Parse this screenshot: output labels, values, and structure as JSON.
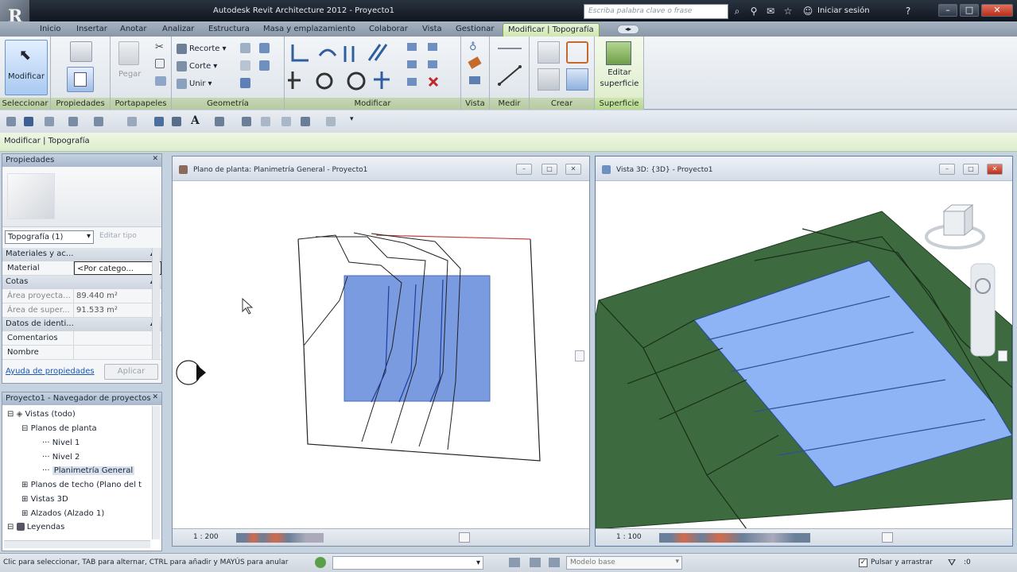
{
  "window": {
    "title": "Autodesk Revit Architecture 2012 -    Proyecto1",
    "search_placeholder": "Escriba palabra clave o frase",
    "signin": "Iniciar sesión"
  },
  "tabs": [
    "Inicio",
    "Insertar",
    "Anotar",
    "Analizar",
    "Estructura",
    "Masa y emplazamiento",
    "Colaborar",
    "Vista",
    "Gestionar",
    "Modificar | Topografía"
  ],
  "ribbon": {
    "modify_label": "Modificar",
    "paste_label": "Pegar",
    "recorte_label": "Recorte",
    "corte_label": "Corte",
    "unir_label": "Unir",
    "editar_label": "Editar",
    "superficie_label": "superficie",
    "panels": {
      "seleccionar": "Seleccionar",
      "propiedades": "Propiedades",
      "portapapeles": "Portapapeles",
      "geometria": "Geometría",
      "modificar": "Modificar",
      "vista": "Vista",
      "medir": "Medir",
      "crear": "Crear",
      "superficie": "Superficie"
    }
  },
  "context": {
    "label": "Modificar | Topografía"
  },
  "properties": {
    "header": "Propiedades",
    "type_selector": "Topografía (1)",
    "edit_type": "Editar tipo",
    "sections": {
      "materials": "Materiales y ac...",
      "cotas": "Cotas",
      "identity": "Datos de identi..."
    },
    "rows": {
      "material_key": "Material",
      "material_val": "<Por catego...",
      "area_proj_key": "Área proyecta...",
      "area_proj_val": "89.440 m²",
      "area_surf_key": "Área de super...",
      "area_surf_val": "91.533 m²",
      "comments_key": "Comentarios",
      "name_key": "Nombre"
    },
    "help_link": "Ayuda de propiedades",
    "apply_button": "Aplicar"
  },
  "browser": {
    "header": "Proyecto1 - Navegador de proyectos",
    "items": {
      "views_all": "Vistas (todo)",
      "planos_planta": "Planos de planta",
      "nivel1": "Nivel 1",
      "nivel2": "Nivel 2",
      "planimetria": "Planimetría General",
      "planos_techo": "Planos de techo (Plano del t",
      "vistas3d": "Vistas 3D",
      "alzados": "Alzados (Alzado 1)",
      "leyendas": "Leyendas"
    }
  },
  "plan_view": {
    "title": "Plano de planta: Planimetría General - Proyecto1",
    "scale": "1 : 200"
  },
  "view3d": {
    "title": "Vista 3D: {3D} - Proyecto1",
    "scale": "1 : 100"
  },
  "status": {
    "text": "Clic para seleccionar, TAB para alternar, CTRL para añadir y MAYÚS para anular",
    "model": "Modelo base",
    "press_drag": "Pulsar y arrastrar"
  },
  "colors": {
    "accent_green": "#cfe6b0",
    "topo_green": "#3d6b3f",
    "pad_blue": "#7a9be0",
    "surface_blue": "#8fb4f5"
  }
}
